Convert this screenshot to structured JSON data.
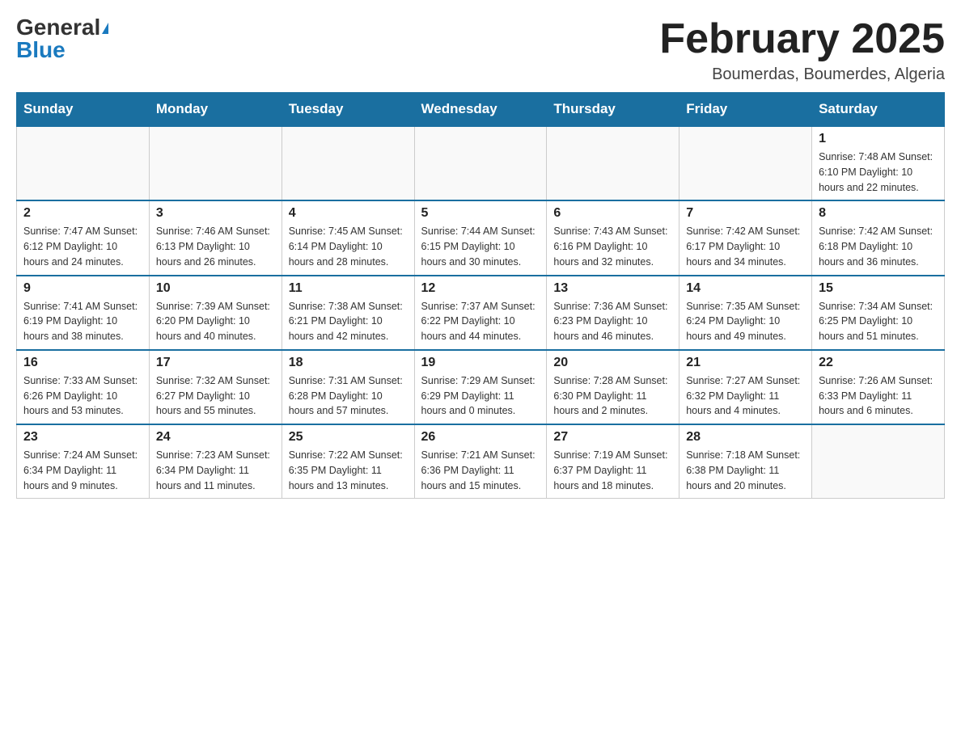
{
  "header": {
    "logo_general": "General",
    "logo_blue": "Blue",
    "title": "February 2025",
    "subtitle": "Boumerdas, Boumerdes, Algeria"
  },
  "days_of_week": [
    "Sunday",
    "Monday",
    "Tuesday",
    "Wednesday",
    "Thursday",
    "Friday",
    "Saturday"
  ],
  "weeks": [
    [
      {
        "day": "",
        "info": ""
      },
      {
        "day": "",
        "info": ""
      },
      {
        "day": "",
        "info": ""
      },
      {
        "day": "",
        "info": ""
      },
      {
        "day": "",
        "info": ""
      },
      {
        "day": "",
        "info": ""
      },
      {
        "day": "1",
        "info": "Sunrise: 7:48 AM\nSunset: 6:10 PM\nDaylight: 10 hours and 22 minutes."
      }
    ],
    [
      {
        "day": "2",
        "info": "Sunrise: 7:47 AM\nSunset: 6:12 PM\nDaylight: 10 hours and 24 minutes."
      },
      {
        "day": "3",
        "info": "Sunrise: 7:46 AM\nSunset: 6:13 PM\nDaylight: 10 hours and 26 minutes."
      },
      {
        "day": "4",
        "info": "Sunrise: 7:45 AM\nSunset: 6:14 PM\nDaylight: 10 hours and 28 minutes."
      },
      {
        "day": "5",
        "info": "Sunrise: 7:44 AM\nSunset: 6:15 PM\nDaylight: 10 hours and 30 minutes."
      },
      {
        "day": "6",
        "info": "Sunrise: 7:43 AM\nSunset: 6:16 PM\nDaylight: 10 hours and 32 minutes."
      },
      {
        "day": "7",
        "info": "Sunrise: 7:42 AM\nSunset: 6:17 PM\nDaylight: 10 hours and 34 minutes."
      },
      {
        "day": "8",
        "info": "Sunrise: 7:42 AM\nSunset: 6:18 PM\nDaylight: 10 hours and 36 minutes."
      }
    ],
    [
      {
        "day": "9",
        "info": "Sunrise: 7:41 AM\nSunset: 6:19 PM\nDaylight: 10 hours and 38 minutes."
      },
      {
        "day": "10",
        "info": "Sunrise: 7:39 AM\nSunset: 6:20 PM\nDaylight: 10 hours and 40 minutes."
      },
      {
        "day": "11",
        "info": "Sunrise: 7:38 AM\nSunset: 6:21 PM\nDaylight: 10 hours and 42 minutes."
      },
      {
        "day": "12",
        "info": "Sunrise: 7:37 AM\nSunset: 6:22 PM\nDaylight: 10 hours and 44 minutes."
      },
      {
        "day": "13",
        "info": "Sunrise: 7:36 AM\nSunset: 6:23 PM\nDaylight: 10 hours and 46 minutes."
      },
      {
        "day": "14",
        "info": "Sunrise: 7:35 AM\nSunset: 6:24 PM\nDaylight: 10 hours and 49 minutes."
      },
      {
        "day": "15",
        "info": "Sunrise: 7:34 AM\nSunset: 6:25 PM\nDaylight: 10 hours and 51 minutes."
      }
    ],
    [
      {
        "day": "16",
        "info": "Sunrise: 7:33 AM\nSunset: 6:26 PM\nDaylight: 10 hours and 53 minutes."
      },
      {
        "day": "17",
        "info": "Sunrise: 7:32 AM\nSunset: 6:27 PM\nDaylight: 10 hours and 55 minutes."
      },
      {
        "day": "18",
        "info": "Sunrise: 7:31 AM\nSunset: 6:28 PM\nDaylight: 10 hours and 57 minutes."
      },
      {
        "day": "19",
        "info": "Sunrise: 7:29 AM\nSunset: 6:29 PM\nDaylight: 11 hours and 0 minutes."
      },
      {
        "day": "20",
        "info": "Sunrise: 7:28 AM\nSunset: 6:30 PM\nDaylight: 11 hours and 2 minutes."
      },
      {
        "day": "21",
        "info": "Sunrise: 7:27 AM\nSunset: 6:32 PM\nDaylight: 11 hours and 4 minutes."
      },
      {
        "day": "22",
        "info": "Sunrise: 7:26 AM\nSunset: 6:33 PM\nDaylight: 11 hours and 6 minutes."
      }
    ],
    [
      {
        "day": "23",
        "info": "Sunrise: 7:24 AM\nSunset: 6:34 PM\nDaylight: 11 hours and 9 minutes."
      },
      {
        "day": "24",
        "info": "Sunrise: 7:23 AM\nSunset: 6:34 PM\nDaylight: 11 hours and 11 minutes."
      },
      {
        "day": "25",
        "info": "Sunrise: 7:22 AM\nSunset: 6:35 PM\nDaylight: 11 hours and 13 minutes."
      },
      {
        "day": "26",
        "info": "Sunrise: 7:21 AM\nSunset: 6:36 PM\nDaylight: 11 hours and 15 minutes."
      },
      {
        "day": "27",
        "info": "Sunrise: 7:19 AM\nSunset: 6:37 PM\nDaylight: 11 hours and 18 minutes."
      },
      {
        "day": "28",
        "info": "Sunrise: 7:18 AM\nSunset: 6:38 PM\nDaylight: 11 hours and 20 minutes."
      },
      {
        "day": "",
        "info": ""
      }
    ]
  ]
}
